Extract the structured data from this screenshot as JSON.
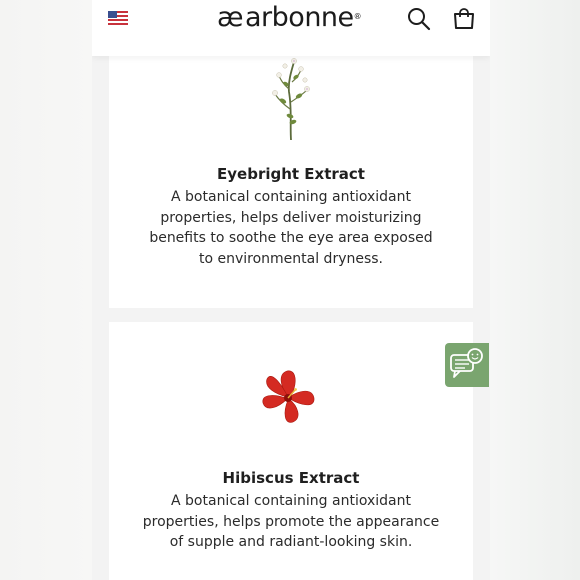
{
  "header": {
    "brand": "arbonne",
    "brand_mark": "æ",
    "trademark": "®",
    "flag_icon": "us-flag-icon",
    "search_icon": "search-icon",
    "bag_icon": "shopping-bag-icon"
  },
  "ingredients": [
    {
      "name": "Eyebright Extract",
      "description": "A botanical containing antioxidant properties, helps deliver moisturizing benefits to soothe the eye area exposed to environmental dryness.",
      "image_icon": "eyebright-plant-icon"
    },
    {
      "name": "Hibiscus Extract",
      "description": "A botanical containing antioxidant properties, helps promote the appearance of supple and radiant-looking skin.",
      "image_icon": "hibiscus-flower-icon"
    }
  ],
  "chat": {
    "icon": "chat-support-icon",
    "color": "#7aa56f"
  }
}
